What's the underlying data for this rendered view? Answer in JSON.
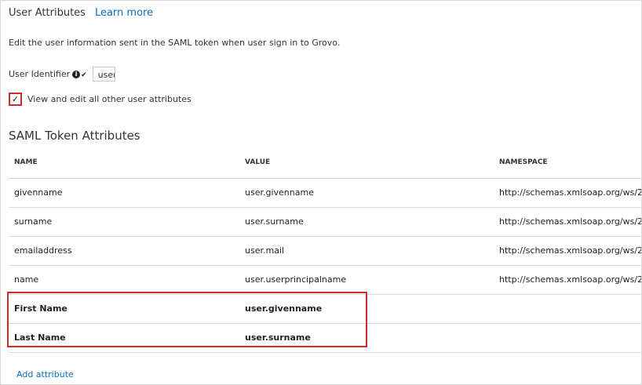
{
  "header": {
    "title": "User Attributes",
    "learn_more": "Learn more"
  },
  "description": "Edit the user information sent in the SAML token when user sign in to Grovo.",
  "user_identifier": {
    "label": "User Identifier",
    "value": "user"
  },
  "view_edit_checkbox": {
    "label": "View and edit all other user attributes",
    "checked": true
  },
  "saml": {
    "title": "SAML Token Attributes",
    "columns": [
      "NAME",
      "VALUE",
      "NAMESPACE"
    ],
    "rows": [
      {
        "name": "givenname",
        "value": "user.givenname",
        "namespace": "http://schemas.xmlsoap.org/ws/2"
      },
      {
        "name": "surname",
        "value": "user.surname",
        "namespace": "http://schemas.xmlsoap.org/ws/2"
      },
      {
        "name": "emailaddress",
        "value": "user.mail",
        "namespace": "http://schemas.xmlsoap.org/ws/2"
      },
      {
        "name": "name",
        "value": "user.userprincipalname",
        "namespace": "http://schemas.xmlsoap.org/ws/2"
      },
      {
        "name": "First Name",
        "value": "user.givenname",
        "namespace": ""
      },
      {
        "name": "Last Name",
        "value": "user.surname",
        "namespace": ""
      }
    ]
  },
  "add_attribute": "Add attribute",
  "colors": {
    "link": "#0b6ebd",
    "highlight": "#d22a2a"
  }
}
